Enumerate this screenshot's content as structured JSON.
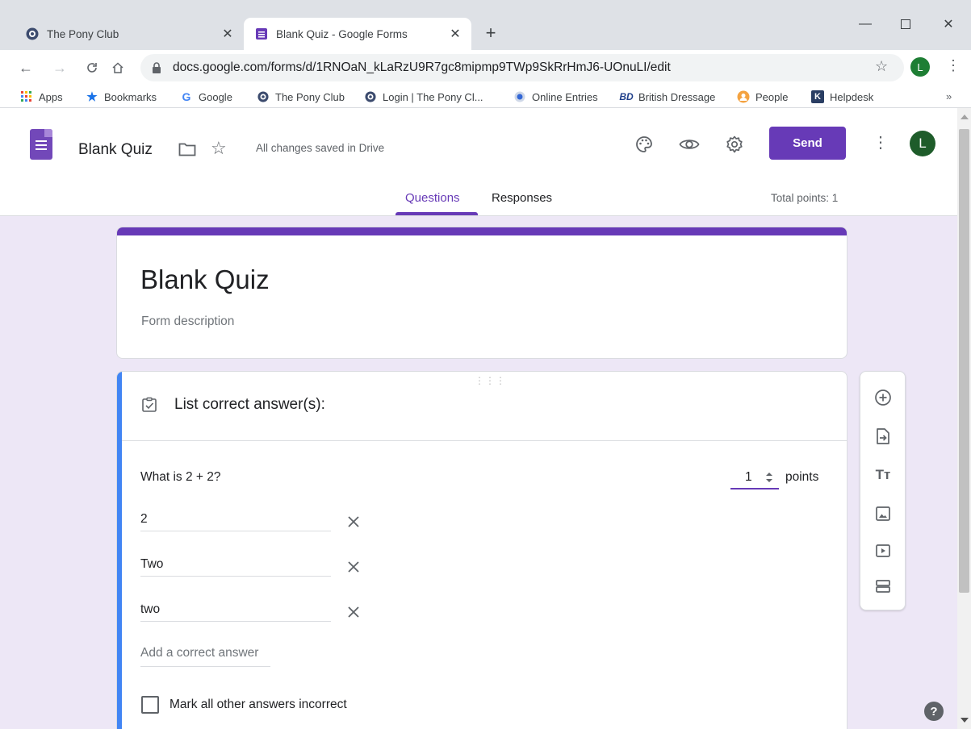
{
  "browser": {
    "tabs": [
      {
        "label": "The Pony Club",
        "icon": "pony-club-favicon",
        "active": false
      },
      {
        "label": "Blank Quiz - Google Forms",
        "icon": "google-forms-favicon",
        "active": true
      }
    ],
    "url": "docs.google.com/forms/d/1RNOaN_kLaRzU9R7gc8mipmp9TWp9SkRrHmJ6-UOnuLI/edit",
    "profile_initial": "L",
    "bookmarks": [
      {
        "label": "Apps",
        "icon": "apps-grid-icon"
      },
      {
        "label": "Bookmarks",
        "icon": "star-bookmark-icon"
      },
      {
        "label": "Google",
        "icon": "google-g-icon"
      },
      {
        "label": "The Pony Club",
        "icon": "pony-club-favicon"
      },
      {
        "label": "Login | The Pony Cl...",
        "icon": "pony-club-favicon"
      },
      {
        "label": "Online Entries",
        "icon": "online-entries-icon"
      },
      {
        "label": "British Dressage",
        "icon": "british-dressage-icon"
      },
      {
        "label": "People",
        "icon": "people-icon"
      },
      {
        "label": "Helpdesk",
        "icon": "helpdesk-icon"
      }
    ],
    "more_bookmarks": "»"
  },
  "header": {
    "doc_title": "Blank Quiz",
    "save_status": "All changes saved in Drive",
    "send_label": "Send",
    "avatar_initial": "L",
    "tabs": [
      {
        "label": "Questions",
        "active": true
      },
      {
        "label": "Responses",
        "active": false
      }
    ],
    "total_points": "Total points: 1"
  },
  "form": {
    "title": "Blank Quiz",
    "description_placeholder": "Form description"
  },
  "question": {
    "answer_key_title": "List correct answer(s):",
    "text": "What is 2 + 2?",
    "points_value": "1",
    "points_label": "points",
    "answers": [
      "2",
      "Two",
      "two"
    ],
    "add_answer_placeholder": "Add a correct answer",
    "mark_incorrect_label": "Mark all other answers incorrect",
    "mark_incorrect_checked": false
  },
  "side_tools": [
    "add-question-icon",
    "import-questions-icon",
    "add-title-icon",
    "add-image-icon",
    "add-video-icon",
    "add-section-icon"
  ],
  "colors": {
    "accent": "#673ab7",
    "canvas_bg": "#ede7f6",
    "question_focus": "#4285f4"
  },
  "help_label": "?"
}
